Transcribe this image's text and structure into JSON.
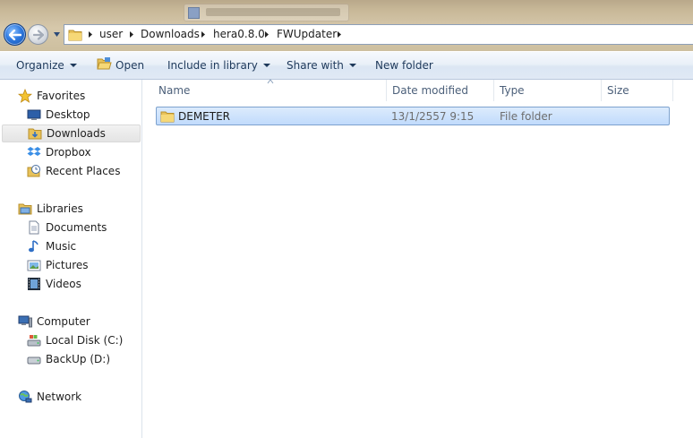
{
  "address": {
    "crumbs": [
      "user",
      "Downloads",
      "hera0.8.0",
      "FWUpdater"
    ]
  },
  "toolbar": {
    "organize": "Organize",
    "open": "Open",
    "include_in_library": "Include in library",
    "share_with": "Share with",
    "new_folder": "New folder"
  },
  "nav": {
    "favorites": {
      "label": "Favorites",
      "items": [
        "Desktop",
        "Downloads",
        "Dropbox",
        "Recent Places"
      ]
    },
    "libraries": {
      "label": "Libraries",
      "items": [
        "Documents",
        "Music",
        "Pictures",
        "Videos"
      ]
    },
    "computer": {
      "label": "Computer",
      "items": [
        "Local Disk (C:)",
        "BackUp (D:)"
      ]
    },
    "network": {
      "label": "Network"
    },
    "selected": "Downloads"
  },
  "columns": [
    "Name",
    "Date modified",
    "Type",
    "Size"
  ],
  "files": [
    {
      "name": "DEMETER",
      "date_modified": "13/1/2557 9:15",
      "type": "File folder",
      "size": ""
    }
  ],
  "colors": {
    "accent": "#3399ff",
    "selection": "#c1dbfc",
    "selection_border": "#7da2ce",
    "command_text": "#1e395b"
  }
}
